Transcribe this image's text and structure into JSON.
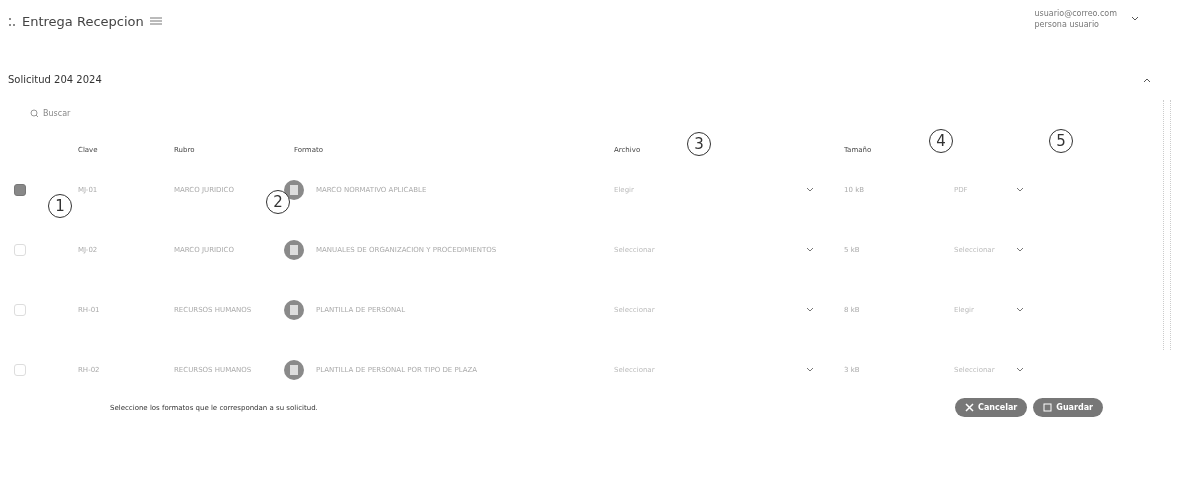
{
  "header": {
    "title": "Entrega Recepcion",
    "user_email": "usuario@correo.com",
    "user_name": "persona usuario"
  },
  "panel": {
    "title": "Solicitud 204 2024",
    "expanded": true
  },
  "search": {
    "placeholder": "Buscar"
  },
  "table": {
    "columns": [
      "Clave",
      "Rubro",
      "Formato",
      "Archivo",
      "Tamaño"
    ],
    "rows": [
      {
        "checked": true,
        "clave": "MJ-01",
        "rubro": "MARCO JURIDICO",
        "formato": "MARCO NORMATIVO APLICABLE",
        "archivo": "Elegir",
        "tamano": "10 kB",
        "column_6": "PDF"
      },
      {
        "checked": false,
        "clave": "MJ-02",
        "rubro": "MARCO JURIDICO",
        "formato": "MANUALES DE ORGANIZACION Y PROCEDIMIENTOS",
        "archivo": "Seleccionar",
        "tamano": "5 kB",
        "column_6": "Seleccionar"
      },
      {
        "checked": false,
        "clave": "RH-01",
        "rubro": "RECURSOS HUMANOS",
        "formato": "PLANTILLA DE PERSONAL",
        "archivo": "Seleccionar",
        "tamano": "8 kB",
        "column_6": "Elegir"
      },
      {
        "checked": false,
        "clave": "RH-02",
        "rubro": "RECURSOS HUMANOS",
        "formato": "PLANTILLA DE PERSONAL POR TIPO DE PLAZA",
        "archivo": "Seleccionar",
        "tamano": "3 kB",
        "column_6": "Seleccionar"
      }
    ]
  },
  "note": "Seleccione los formatos que le correspondan a su solicitud.",
  "buttons": [
    {
      "label": "Cancelar",
      "kind": "cancel"
    },
    {
      "label": "Guardar",
      "kind": "save"
    }
  ],
  "annotations": [
    "1",
    "2",
    "3",
    "4",
    "5"
  ]
}
